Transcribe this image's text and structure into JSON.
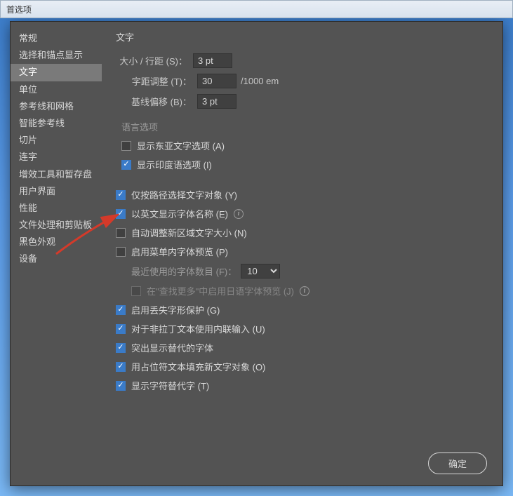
{
  "window": {
    "title": "首选项"
  },
  "sidebar": {
    "items": [
      {
        "label": "常规",
        "selected": false
      },
      {
        "label": "选择和锚点显示",
        "selected": false
      },
      {
        "label": "文字",
        "selected": true
      },
      {
        "label": "单位",
        "selected": false
      },
      {
        "label": "参考线和网格",
        "selected": false
      },
      {
        "label": "智能参考线",
        "selected": false
      },
      {
        "label": "切片",
        "selected": false
      },
      {
        "label": "连字",
        "selected": false
      },
      {
        "label": "增效工具和暂存盘",
        "selected": false
      },
      {
        "label": "用户界面",
        "selected": false
      },
      {
        "label": "性能",
        "selected": false
      },
      {
        "label": "文件处理和剪贴板",
        "selected": false
      },
      {
        "label": "黑色外观",
        "selected": false
      },
      {
        "label": "设备",
        "selected": false
      }
    ]
  },
  "content": {
    "title": "文字",
    "fields": {
      "size_leading": {
        "label": "大小 / 行距 (S)：",
        "value": "3 pt"
      },
      "tracking": {
        "label": "字距调整 (T)：",
        "value": "30",
        "suffix": "/1000 em"
      },
      "baseline": {
        "label": "基线偏移 (B)：",
        "value": "3 pt"
      }
    },
    "lang_section": {
      "title": "语言选项",
      "items": [
        {
          "label": "显示东亚文字选项 (A)",
          "checked": false
        },
        {
          "label": "显示印度语选项 (I)",
          "checked": true
        }
      ]
    },
    "checks": [
      {
        "label": "仅按路径选择文字对象 (Y)",
        "checked": true,
        "info": false
      },
      {
        "label": "以英文显示字体名称 (E)",
        "checked": true,
        "info": true
      },
      {
        "label": "自动调整新区域文字大小 (N)",
        "checked": false,
        "info": false
      },
      {
        "label": "启用菜单内字体预览 (P)",
        "checked": false,
        "info": false
      }
    ],
    "recent_fonts": {
      "label": "最近使用的字体数目 (F)：",
      "value": "10"
    },
    "checks2": [
      {
        "label": "在\"查找更多\"中启用日语字体预览 (J)",
        "checked": false,
        "info": true,
        "disabled": true
      },
      {
        "label": "启用丢失字形保护 (G)",
        "checked": true,
        "info": false
      },
      {
        "label": "对于非拉丁文本使用内联输入 (U)",
        "checked": true,
        "info": false
      },
      {
        "label": "突出显示替代的字体",
        "checked": true,
        "info": false
      },
      {
        "label": "用占位符文本填充新文字对象 (O)",
        "checked": true,
        "info": false
      },
      {
        "label": "显示字符替代字 (T)",
        "checked": true,
        "info": false
      }
    ]
  },
  "buttons": {
    "ok": "确定"
  }
}
